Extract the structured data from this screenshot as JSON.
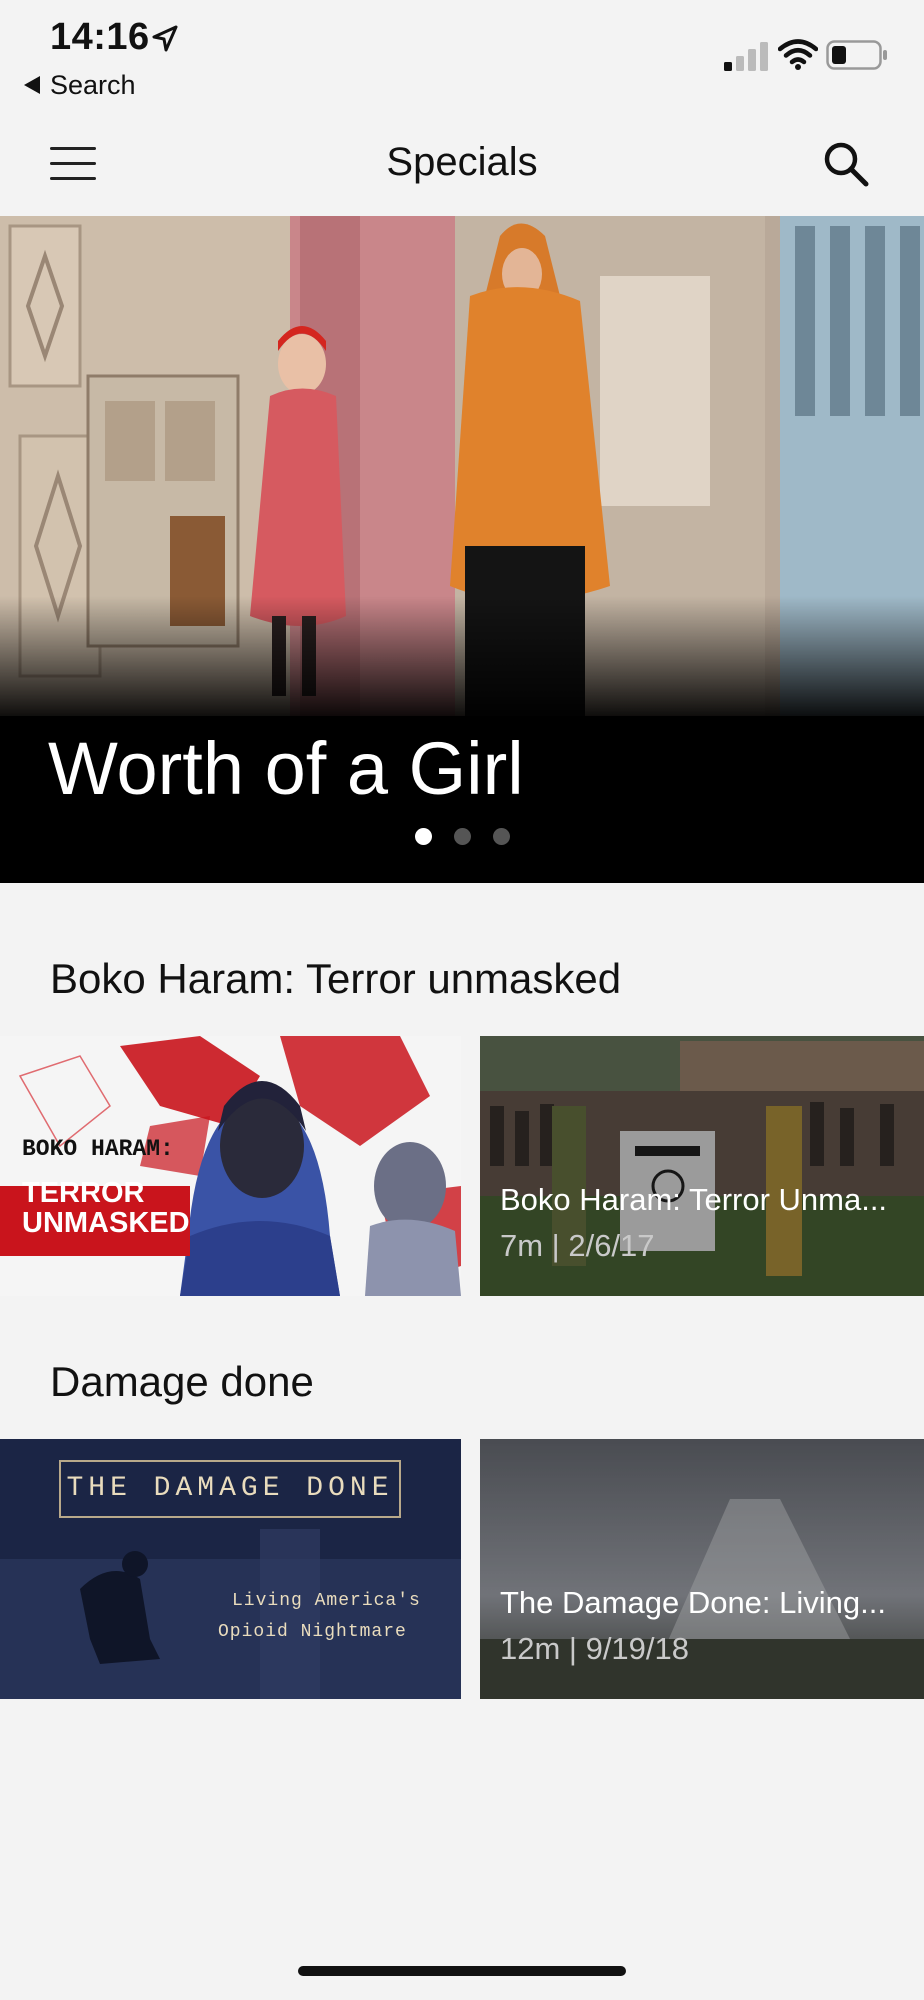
{
  "status": {
    "time": "14:16",
    "back_label": "Search"
  },
  "nav": {
    "title": "Specials"
  },
  "hero": {
    "title": "Worth of a Girl",
    "slides": 3,
    "active_slide": 1
  },
  "sections": [
    {
      "title": "Boko Haram: Terror unmasked",
      "poster_text": {
        "line1": "BOKO HARAM:",
        "line2": "TERROR",
        "line3": "UNMASKED"
      },
      "video": {
        "title": "Boko Haram: Terror Unma...",
        "meta": "7m | 2/6/17"
      }
    },
    {
      "title": "Damage done",
      "poster_text": {
        "line1": "THE DAMAGE DONE",
        "line2": "Living America's",
        "line3": "Opioid Nightmare"
      },
      "video": {
        "title": "The Damage Done: Living...",
        "meta": "12m | 9/19/18"
      }
    }
  ],
  "colors": {
    "background": "#f3f3f3",
    "hero_bg": "#000000",
    "poster_red": "#c9141c",
    "poster_navy": "#1b2545"
  }
}
